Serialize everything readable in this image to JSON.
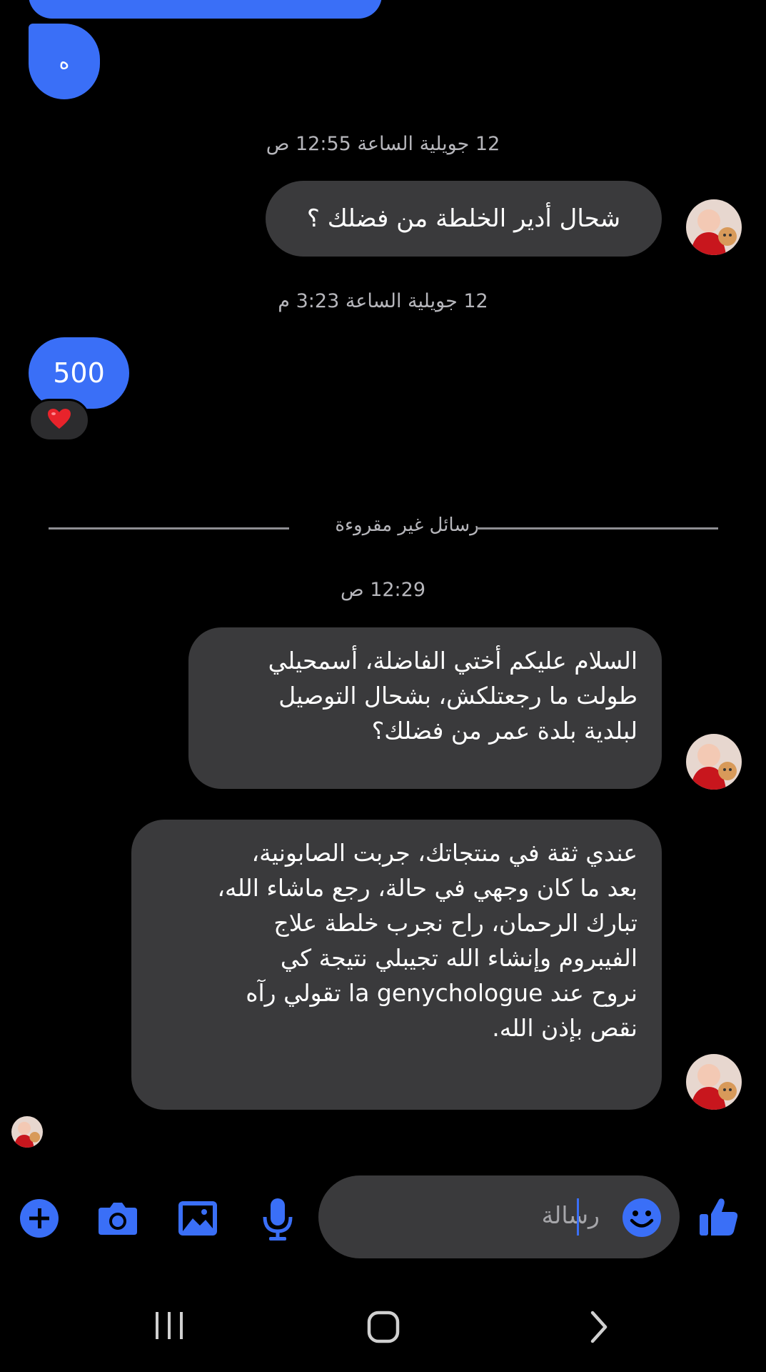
{
  "messages": {
    "top_bubble_char": "ه",
    "timestamp_1": "12 جويلية الساعة 12:55 ص",
    "outgoing_1": "شحال أدير الخلطة من فضلك ؟",
    "timestamp_2": "12 جويلية الساعة 3:23 م",
    "incoming_1": "500",
    "reaction_1": "❤️",
    "unread_divider": "رسائل غير مقروءة",
    "timestamp_3": "12:29 ص",
    "outgoing_2": "السلام عليكم أختي الفاضلة، أسمحيلي\nطولت ما رجعتلكش، بشحال التوصيل\nلبلدية بلدة عمر من فضلك؟",
    "outgoing_3": "عندي ثقة في منتجاتك، جربت الصابونية،\nبعد ما كان وجهي في حالة، رجع ماشاء الله،\nتبارك الرحمان، راح نجرب خلطة علاج\nالفيبروم وإنشاء الله تجيبلي نتيجة كي\nنروح عند la genychologue تقولي رآه\nنقص بإذن الله."
  },
  "composer": {
    "placeholder": "رسالة",
    "icons": [
      "plus-icon",
      "camera-icon",
      "image-icon",
      "microphone-icon",
      "emoji-icon",
      "thumbs-up-icon"
    ]
  },
  "navbar": {
    "icons": [
      "recent-apps-icon",
      "home-icon",
      "back-icon"
    ]
  },
  "colors": {
    "accent": "#3a6ff7",
    "bubble_gray": "#3a3a3c",
    "background": "#000000"
  }
}
